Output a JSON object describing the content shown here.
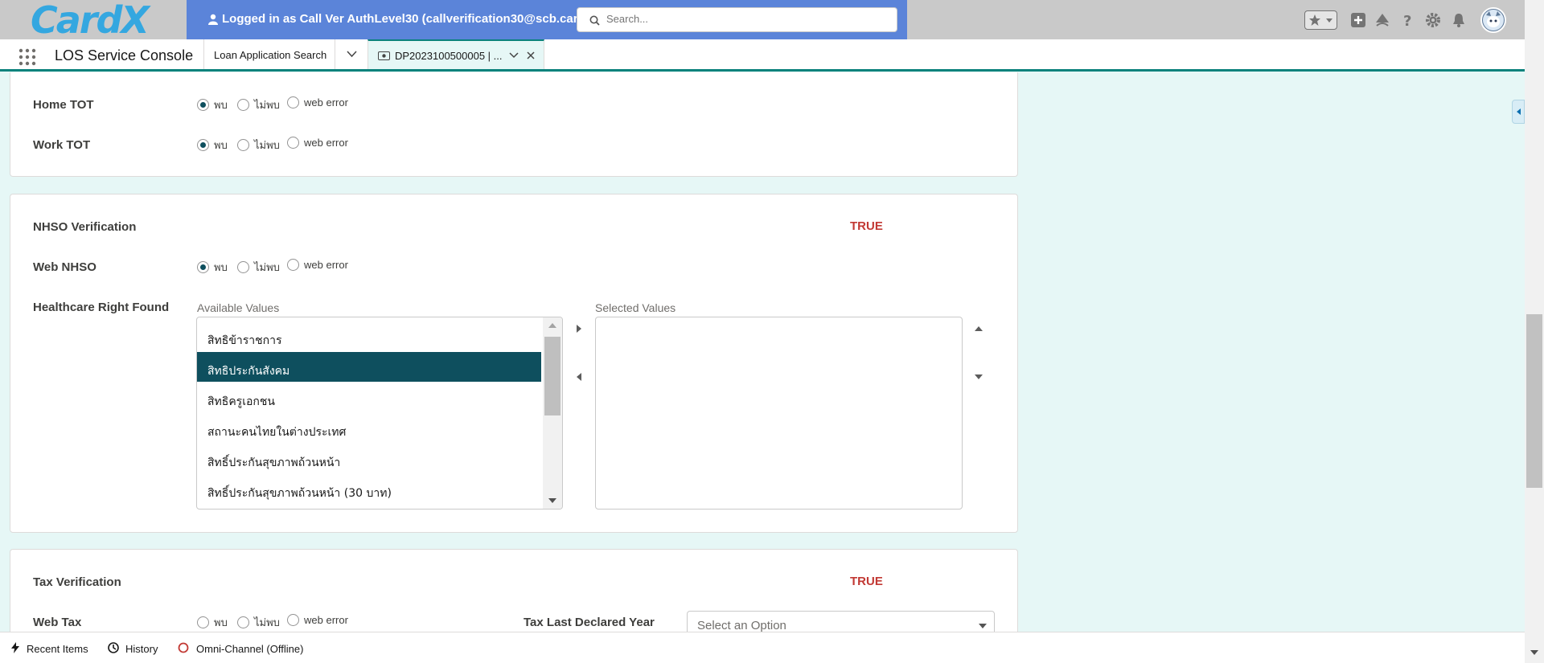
{
  "header": {
    "logo_text": "CardX",
    "login_banner": "Logged in as Call Ver AuthLevel30 (callverification30@scb.cardx.co.th",
    "search_placeholder": "Search...",
    "brand_color": "#5b84d9"
  },
  "nav": {
    "app_name": "LOS Service Console",
    "tabs": [
      {
        "label": "Loan Application Search"
      },
      {
        "label": "DP2023100500005 | ..."
      }
    ]
  },
  "tot_section": {
    "rows": [
      {
        "label": "Home TOT",
        "selected": "พบ"
      },
      {
        "label": "Work TOT",
        "selected": "พบ"
      }
    ]
  },
  "radio_options": [
    "พบ",
    "ไม่พบ",
    "web error"
  ],
  "nhso_section": {
    "title": "NHSO Verification",
    "status": "TRUE",
    "web_label": "Web NHSO",
    "web_selected": "พบ",
    "healthcare_label": "Healthcare Right Found",
    "available_caption": "Available Values",
    "selected_caption": "Selected Values",
    "available_values": [
      "สิทธิข้าราชการ",
      "สิทธิประกันสังคม",
      "สิทธิครูเอกชน",
      "สถานะคนไทยในต่างประเทศ",
      "สิทธิ์ประกันสุขภาพถ้วนหน้า",
      "สิทธิ์ประกันสุขภาพถ้วนหน้า (30 บาท)"
    ],
    "highlighted_value": "สิทธิประกันสังคม",
    "selected_values": []
  },
  "tax_section": {
    "title": "Tax Verification",
    "status": "TRUE",
    "web_label": "Web Tax",
    "web_selected": "",
    "year_label": "Tax Last Declared Year",
    "year_placeholder": "Select an Option"
  },
  "utility_bar": {
    "items": [
      "Recent Items",
      "History",
      "Omni-Channel (Offline)"
    ]
  },
  "colors": {
    "accent": "#0b827c",
    "selected_option": "#0e4f5e",
    "status_true": "#c23934",
    "offline": "#c23934"
  }
}
